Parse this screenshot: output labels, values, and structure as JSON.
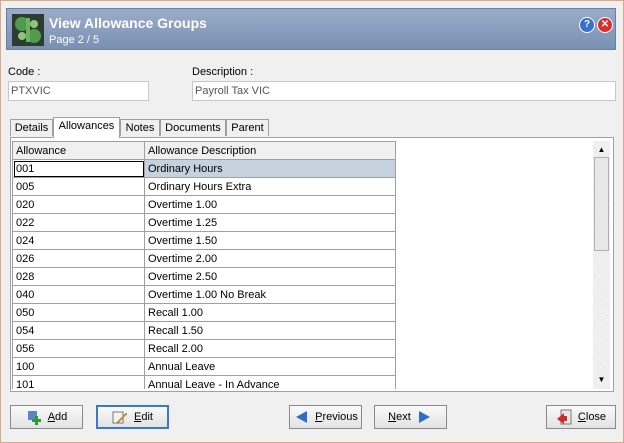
{
  "header": {
    "title": "View Allowance Groups",
    "subtitle": "Page 2 / 5",
    "help": "?",
    "close": "✕"
  },
  "form": {
    "code_label": "Code :",
    "code_value": "PTXVIC",
    "description_label": "Description :",
    "description_value": "Payroll Tax VIC"
  },
  "tabs": [
    "Details",
    "Allowances",
    "Notes",
    "Documents",
    "Parent"
  ],
  "grid": {
    "columns": [
      "Allowance",
      "Allowance Description"
    ],
    "rows": [
      [
        "001",
        "Ordinary Hours"
      ],
      [
        "005",
        "Ordinary Hours Extra"
      ],
      [
        "020",
        "Overtime 1.00"
      ],
      [
        "022",
        "Overtime 1.25"
      ],
      [
        "024",
        "Overtime 1.50"
      ],
      [
        "026",
        "Overtime 2.00"
      ],
      [
        "028",
        "Overtime 2.50"
      ],
      [
        "040",
        "Overtime 1.00 No Break"
      ],
      [
        "050",
        "Recall 1.00"
      ],
      [
        "054",
        "Recall 1.50"
      ],
      [
        "056",
        "Recall 2.00"
      ],
      [
        "100",
        "Annual Leave"
      ],
      [
        "101",
        "Annual Leave - In Advance"
      ]
    ]
  },
  "buttons": {
    "add": "Add",
    "edit": "Edit",
    "previous": "Previous",
    "next": "Next",
    "close": "Close"
  },
  "colors": {
    "header": "#8ea3c1",
    "selection": "#c4d2e0",
    "focus": "#3a78c8"
  }
}
